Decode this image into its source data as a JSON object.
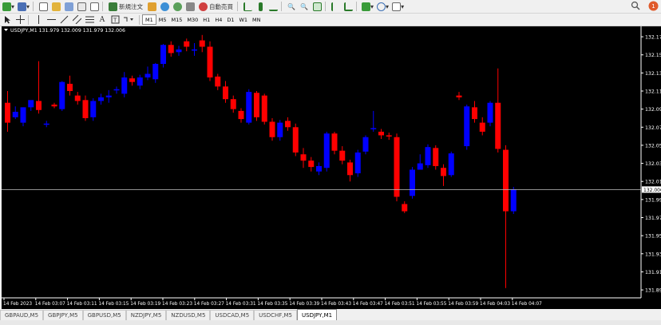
{
  "toolbar": {
    "new_order_label": "新規注文",
    "auto_trade_label": "自動売買",
    "timeframes": [
      "M1",
      "M5",
      "M15",
      "M30",
      "H1",
      "H4",
      "D1",
      "W1",
      "MN"
    ],
    "active_timeframe": "M1",
    "notification_count": "1"
  },
  "chart": {
    "header": "USDJPY,M1  131.979 132.009 131.979 132.006",
    "current_price_label": "132.006",
    "background": "#000000",
    "bull_color": "#0000ff",
    "bear_color": "#ff0000",
    "bid_line_color": "#c0c0c0"
  },
  "chart_data": {
    "type": "candlestick",
    "symbol": "USDJPY",
    "timeframe": "M1",
    "y_ticks": [
      "132.175",
      "132.155",
      "132.135",
      "132.115",
      "132.095",
      "132.075",
      "132.055",
      "132.035",
      "132.015",
      "131.995",
      "131.975",
      "131.955",
      "131.935",
      "131.915",
      "131.895"
    ],
    "x_ticks": [
      "14 Feb 2023",
      "14 Feb 03:07",
      "14 Feb 03:11",
      "14 Feb 03:15",
      "14 Feb 03:19",
      "14 Feb 03:23",
      "14 Feb 03:27",
      "14 Feb 03:31",
      "14 Feb 03:35",
      "14 Feb 03:39",
      "14 Feb 03:43",
      "14 Feb 03:47",
      "14 Feb 03:51",
      "14 Feb 03:55",
      "14 Feb 03:59",
      "14 Feb 04:03",
      "14 Feb 04:07"
    ],
    "ylim": [
      131.888,
      132.183
    ],
    "current_price": 132.006,
    "candles": [
      {
        "o": 132.102,
        "h": 132.115,
        "c": 132.08,
        "l": 132.07
      },
      {
        "o": 132.086,
        "h": 132.098,
        "c": 132.092,
        "l": 132.084
      },
      {
        "o": 132.08,
        "h": 132.097,
        "c": 132.097,
        "l": 132.076
      },
      {
        "o": 132.097,
        "h": 132.104,
        "c": 132.105,
        "l": 132.093
      },
      {
        "o": 132.104,
        "h": 132.148,
        "c": 132.094,
        "l": 132.09
      },
      {
        "o": 132.078,
        "h": 132.082,
        "c": 132.079,
        "l": 132.075
      },
      {
        "o": 132.1,
        "h": 132.102,
        "c": 132.098,
        "l": 132.096
      },
      {
        "o": 132.095,
        "h": 132.126,
        "c": 132.125,
        "l": 132.093
      },
      {
        "o": 132.123,
        "h": 132.132,
        "c": 132.115,
        "l": 132.11
      },
      {
        "o": 132.11,
        "h": 132.114,
        "c": 132.104,
        "l": 132.1
      },
      {
        "o": 132.105,
        "h": 132.11,
        "c": 132.085,
        "l": 132.082
      },
      {
        "o": 132.086,
        "h": 132.107,
        "c": 132.104,
        "l": 132.082
      },
      {
        "o": 132.104,
        "h": 132.112,
        "c": 132.108,
        "l": 132.1
      },
      {
        "o": 132.108,
        "h": 132.116,
        "c": 132.11,
        "l": 132.102
      },
      {
        "o": 132.116,
        "h": 132.12,
        "c": 132.117,
        "l": 132.112
      },
      {
        "o": 132.112,
        "h": 132.136,
        "c": 132.13,
        "l": 132.108
      },
      {
        "o": 132.129,
        "h": 132.132,
        "c": 132.125,
        "l": 132.121
      },
      {
        "o": 132.121,
        "h": 132.133,
        "c": 132.13,
        "l": 132.117
      },
      {
        "o": 132.13,
        "h": 132.142,
        "c": 132.134,
        "l": 132.127
      },
      {
        "o": 132.128,
        "h": 132.146,
        "c": 132.145,
        "l": 132.124
      },
      {
        "o": 132.145,
        "h": 132.167,
        "c": 132.166,
        "l": 132.141
      },
      {
        "o": 132.166,
        "h": 132.17,
        "c": 132.157,
        "l": 132.153
      },
      {
        "o": 132.158,
        "h": 132.165,
        "c": 132.161,
        "l": 132.154
      },
      {
        "o": 132.17,
        "h": 132.173,
        "c": 132.164,
        "l": 132.159
      },
      {
        "o": 132.16,
        "h": 132.168,
        "c": 132.161,
        "l": 132.154
      },
      {
        "o": 132.171,
        "h": 132.177,
        "c": 132.164,
        "l": 132.158
      },
      {
        "o": 132.164,
        "h": 132.17,
        "c": 132.13,
        "l": 132.126
      },
      {
        "o": 132.131,
        "h": 132.134,
        "c": 132.12,
        "l": 132.116
      },
      {
        "o": 132.12,
        "h": 132.126,
        "c": 132.106,
        "l": 132.102
      },
      {
        "o": 132.106,
        "h": 132.11,
        "c": 132.095,
        "l": 132.091
      },
      {
        "o": 132.093,
        "h": 132.096,
        "c": 132.084,
        "l": 132.08
      },
      {
        "o": 132.08,
        "h": 132.117,
        "c": 132.114,
        "l": 132.078
      },
      {
        "o": 132.113,
        "h": 132.115,
        "c": 132.086,
        "l": 132.082
      },
      {
        "o": 132.11,
        "h": 132.112,
        "c": 132.081,
        "l": 132.078
      },
      {
        "o": 132.081,
        "h": 132.085,
        "c": 132.064,
        "l": 132.06
      },
      {
        "o": 132.064,
        "h": 132.083,
        "c": 132.08,
        "l": 132.06
      },
      {
        "o": 132.082,
        "h": 132.086,
        "c": 132.075,
        "l": 132.071
      },
      {
        "o": 132.075,
        "h": 132.079,
        "c": 132.047,
        "l": 132.043
      },
      {
        "o": 132.045,
        "h": 132.052,
        "c": 132.038,
        "l": 132.03
      },
      {
        "o": 132.038,
        "h": 132.042,
        "c": 132.031,
        "l": 132.026
      },
      {
        "o": 132.026,
        "h": 132.036,
        "c": 132.032,
        "l": 132.022
      },
      {
        "o": 132.03,
        "h": 132.07,
        "c": 132.068,
        "l": 132.026
      },
      {
        "o": 132.068,
        "h": 132.07,
        "c": 132.049,
        "l": 132.045
      },
      {
        "o": 132.049,
        "h": 132.054,
        "c": 132.038,
        "l": 132.034
      },
      {
        "o": 132.036,
        "h": 132.039,
        "c": 132.022,
        "l": 132.015
      },
      {
        "o": 132.024,
        "h": 132.05,
        "c": 132.047,
        "l": 132.02
      },
      {
        "o": 132.048,
        "h": 132.066,
        "c": 132.064,
        "l": 132.045
      },
      {
        "o": 132.073,
        "h": 132.093,
        "c": 132.074,
        "l": 132.07
      },
      {
        "o": 132.07,
        "h": 132.073,
        "c": 132.066,
        "l": 132.062
      },
      {
        "o": 132.066,
        "h": 132.069,
        "c": 132.065,
        "l": 132.061
      },
      {
        "o": 132.064,
        "h": 132.068,
        "c": 131.998,
        "l": 131.993
      },
      {
        "o": 131.99,
        "h": 131.993,
        "c": 131.982,
        "l": 131.98
      },
      {
        "o": 131.999,
        "h": 132.031,
        "c": 132.028,
        "l": 131.996
      },
      {
        "o": 132.028,
        "h": 132.045,
        "c": 132.035,
        "l": 132.031
      },
      {
        "o": 132.033,
        "h": 132.056,
        "c": 132.053,
        "l": 132.03
      },
      {
        "o": 132.052,
        "h": 132.055,
        "c": 132.032,
        "l": 132.028
      },
      {
        "o": 132.03,
        "h": 132.034,
        "c": 132.021,
        "l": 132.01
      },
      {
        "o": 132.022,
        "h": 132.048,
        "c": 132.046,
        "l": 132.02
      },
      {
        "o": 132.11,
        "h": 132.114,
        "c": 132.108,
        "l": 132.105
      },
      {
        "o": 132.054,
        "h": 132.1,
        "c": 132.098,
        "l": 132.05
      },
      {
        "o": 132.097,
        "h": 132.104,
        "c": 132.084,
        "l": 132.08
      },
      {
        "o": 132.08,
        "h": 132.086,
        "c": 132.07,
        "l": 132.066
      },
      {
        "o": 132.08,
        "h": 132.104,
        "c": 132.102,
        "l": 132.076
      },
      {
        "o": 132.102,
        "h": 132.14,
        "c": 132.051,
        "l": 132.047
      },
      {
        "o": 132.05,
        "h": 132.055,
        "c": 131.982,
        "l": 131.897
      },
      {
        "o": 131.982,
        "h": 132.009,
        "c": 132.006,
        "l": 131.979
      }
    ]
  },
  "tabs": [
    {
      "label": "GBPAUD,M5",
      "active": false
    },
    {
      "label": "GBPJPY,M5",
      "active": false
    },
    {
      "label": "GBPUSD,M5",
      "active": false
    },
    {
      "label": "NZDJPY,M5",
      "active": false
    },
    {
      "label": "NZDUSD,M5",
      "active": false
    },
    {
      "label": "USDCAD,M5",
      "active": false
    },
    {
      "label": "USDCHF,M5",
      "active": false
    },
    {
      "label": "USDJPY,M1",
      "active": true
    }
  ]
}
